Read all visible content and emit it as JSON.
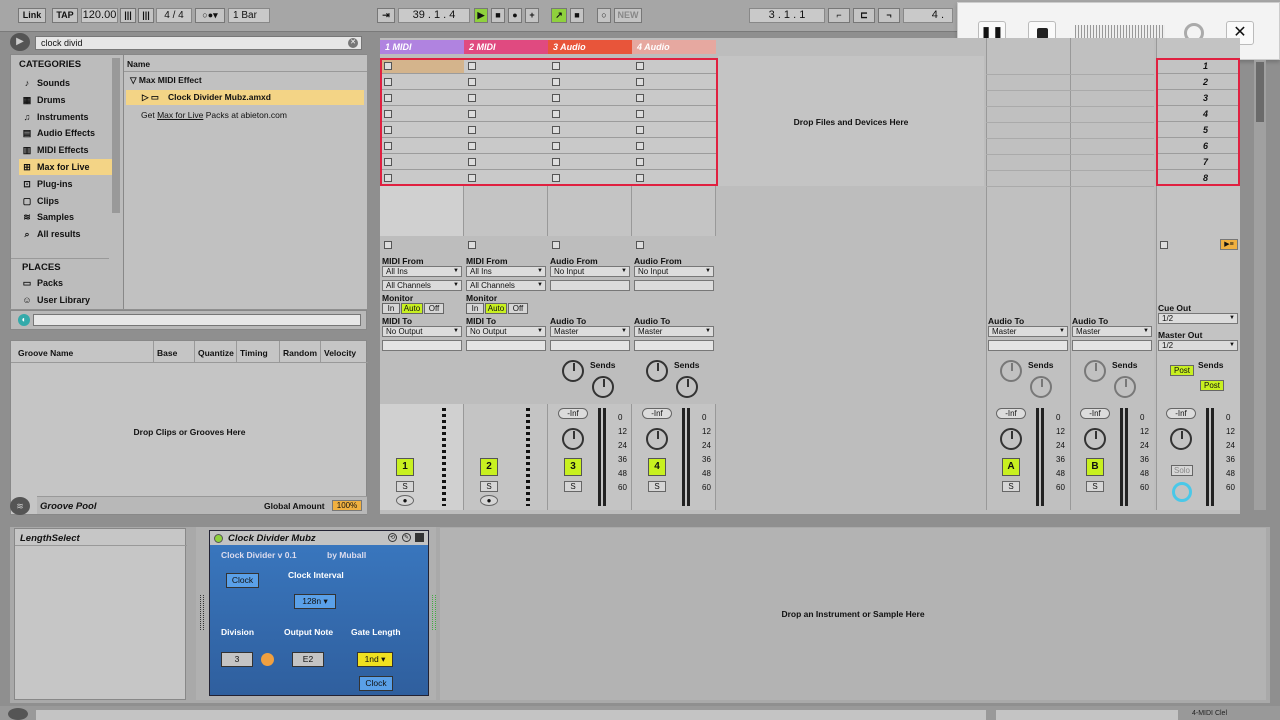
{
  "transport": {
    "link": "Link",
    "tap": "TAP",
    "tempo": "120.00",
    "time_sig": "4 / 4",
    "quant": "1 Bar",
    "position": "39 . 1 . 4",
    "new": "NEW",
    "loop_start": "3 . 1 . 1",
    "loop_len": "4 ."
  },
  "browser": {
    "search": "clock divid",
    "categories_title": "CATEGORIES",
    "categories": [
      "Sounds",
      "Drums",
      "Instruments",
      "Audio Effects",
      "MIDI Effects",
      "Max for Live",
      "Plug-ins",
      "Clips",
      "Samples",
      "All results"
    ],
    "places_title": "PLACES",
    "places": [
      "Packs",
      "User Library"
    ],
    "name_header": "Name",
    "folder": "Max MIDI Effect",
    "file": "Clock Divider Mubz.amxd",
    "get_prefix": "Get ",
    "get_link": "Max for Live",
    "get_suffix": " Packs at abieton.com"
  },
  "groove": {
    "columns": [
      "Groove Name",
      "Base",
      "Quantize",
      "Timing",
      "Random",
      "Velocity"
    ],
    "drop": "Drop Clips or Grooves Here",
    "pool": "Groove Pool",
    "global_label": "Global Amount",
    "global_value": "100%"
  },
  "session": {
    "tracks": [
      {
        "name": "1 MIDI",
        "color": "#b083e0"
      },
      {
        "name": "2 MIDI",
        "color": "#e04a80"
      },
      {
        "name": "3 Audio",
        "color": "#e8553a"
      },
      {
        "name": "4 Audio",
        "color": "#e6a8a0"
      }
    ],
    "drop": "Drop Files and Devices Here",
    "scenes": [
      "1",
      "2",
      "3",
      "4",
      "5",
      "6",
      "7",
      "8"
    ],
    "midi_from": "MIDI From",
    "audio_from": "Audio From",
    "all_ins": "All Ins",
    "all_channels": "All Channels",
    "no_input": "No Input",
    "monitor": "Monitor",
    "mon_in": "In",
    "mon_auto": "Auto",
    "mon_off": "Off",
    "midi_to": "MIDI To",
    "audio_to": "Audio To",
    "no_output": "No Output",
    "master": "Master",
    "sends": "Sends",
    "send_a": "A",
    "send_b": "B",
    "inf": "-Inf",
    "scale": [
      "0",
      "12",
      "24",
      "36",
      "48",
      "60"
    ],
    "s": "S",
    "solo": "Solo",
    "post": "Post",
    "cue_out": "Cue Out",
    "master_out": "Master Out",
    "half": "1/2",
    "returns": [
      "A",
      "B"
    ],
    "nums": [
      "1",
      "2",
      "3",
      "4"
    ]
  },
  "device": {
    "length_select": "LengthSelect",
    "title": "Clock Divider Mubz",
    "version": "Clock Divider v 0.1",
    "by": "by Muball",
    "clock_btn": "Clock",
    "interval_label": "Clock Interval",
    "interval_value": "128n",
    "division_label": "Division",
    "output_label": "Output Note",
    "gate_label": "Gate Length",
    "division_value": "3",
    "output_value": "E2",
    "gate_value": "1nd",
    "clock_bottom": "Clock",
    "drop_instrument": "Drop an Instrument or Sample Here",
    "status_right": "4-MIDI  Clel"
  },
  "recorder": {
    "pause": "pause-icon",
    "stop": "stop-icon",
    "close": "close-icon"
  }
}
